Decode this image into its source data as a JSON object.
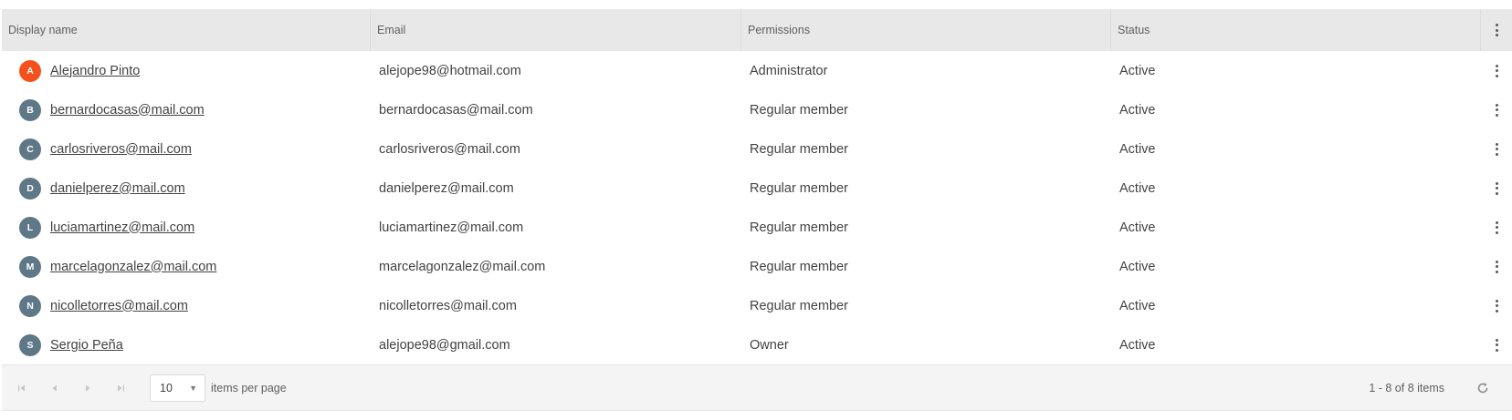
{
  "columns": {
    "name": "Display name",
    "email": "Email",
    "permissions": "Permissions",
    "status": "Status",
    "menu_icon": "more-vertical-icon"
  },
  "rows": [
    {
      "initial": "A",
      "avatar_color": "#f4511e",
      "name": "Alejandro Pinto",
      "email": "alejope98@hotmail.com",
      "permissions": "Administrator",
      "status": "Active"
    },
    {
      "initial": "B",
      "avatar_color": "#5f7888",
      "name": "bernardocasas@mail.com",
      "email": "bernardocasas@mail.com",
      "permissions": "Regular member",
      "status": "Active"
    },
    {
      "initial": "C",
      "avatar_color": "#5f7888",
      "name": "carlosriveros@mail.com",
      "email": "carlosriveros@mail.com",
      "permissions": "Regular member",
      "status": "Active"
    },
    {
      "initial": "D",
      "avatar_color": "#5f7888",
      "name": "danielperez@mail.com",
      "email": "danielperez@mail.com",
      "permissions": "Regular member",
      "status": "Active"
    },
    {
      "initial": "L",
      "avatar_color": "#5f7888",
      "name": "luciamartinez@mail.com",
      "email": "luciamartinez@mail.com",
      "permissions": "Regular member",
      "status": "Active"
    },
    {
      "initial": "M",
      "avatar_color": "#5f7888",
      "name": "marcelagonzalez@mail.com",
      "email": "marcelagonzalez@mail.com",
      "permissions": "Regular member",
      "status": "Active"
    },
    {
      "initial": "N",
      "avatar_color": "#5f7888",
      "name": "nicolletorres@mail.com",
      "email": "nicolletorres@mail.com",
      "permissions": "Regular member",
      "status": "Active"
    },
    {
      "initial": "S",
      "avatar_color": "#5f7888",
      "name": "Sergio Peña",
      "email": "alejope98@gmail.com",
      "permissions": "Owner",
      "status": "Active"
    }
  ],
  "pager": {
    "page_size": "10",
    "per_page_label": "items per page",
    "info": "1 - 8 of 8 items",
    "first_icon": "first-page-icon",
    "prev_icon": "previous-page-icon",
    "next_icon": "next-page-icon",
    "last_icon": "last-page-icon",
    "refresh_icon": "refresh-icon"
  }
}
